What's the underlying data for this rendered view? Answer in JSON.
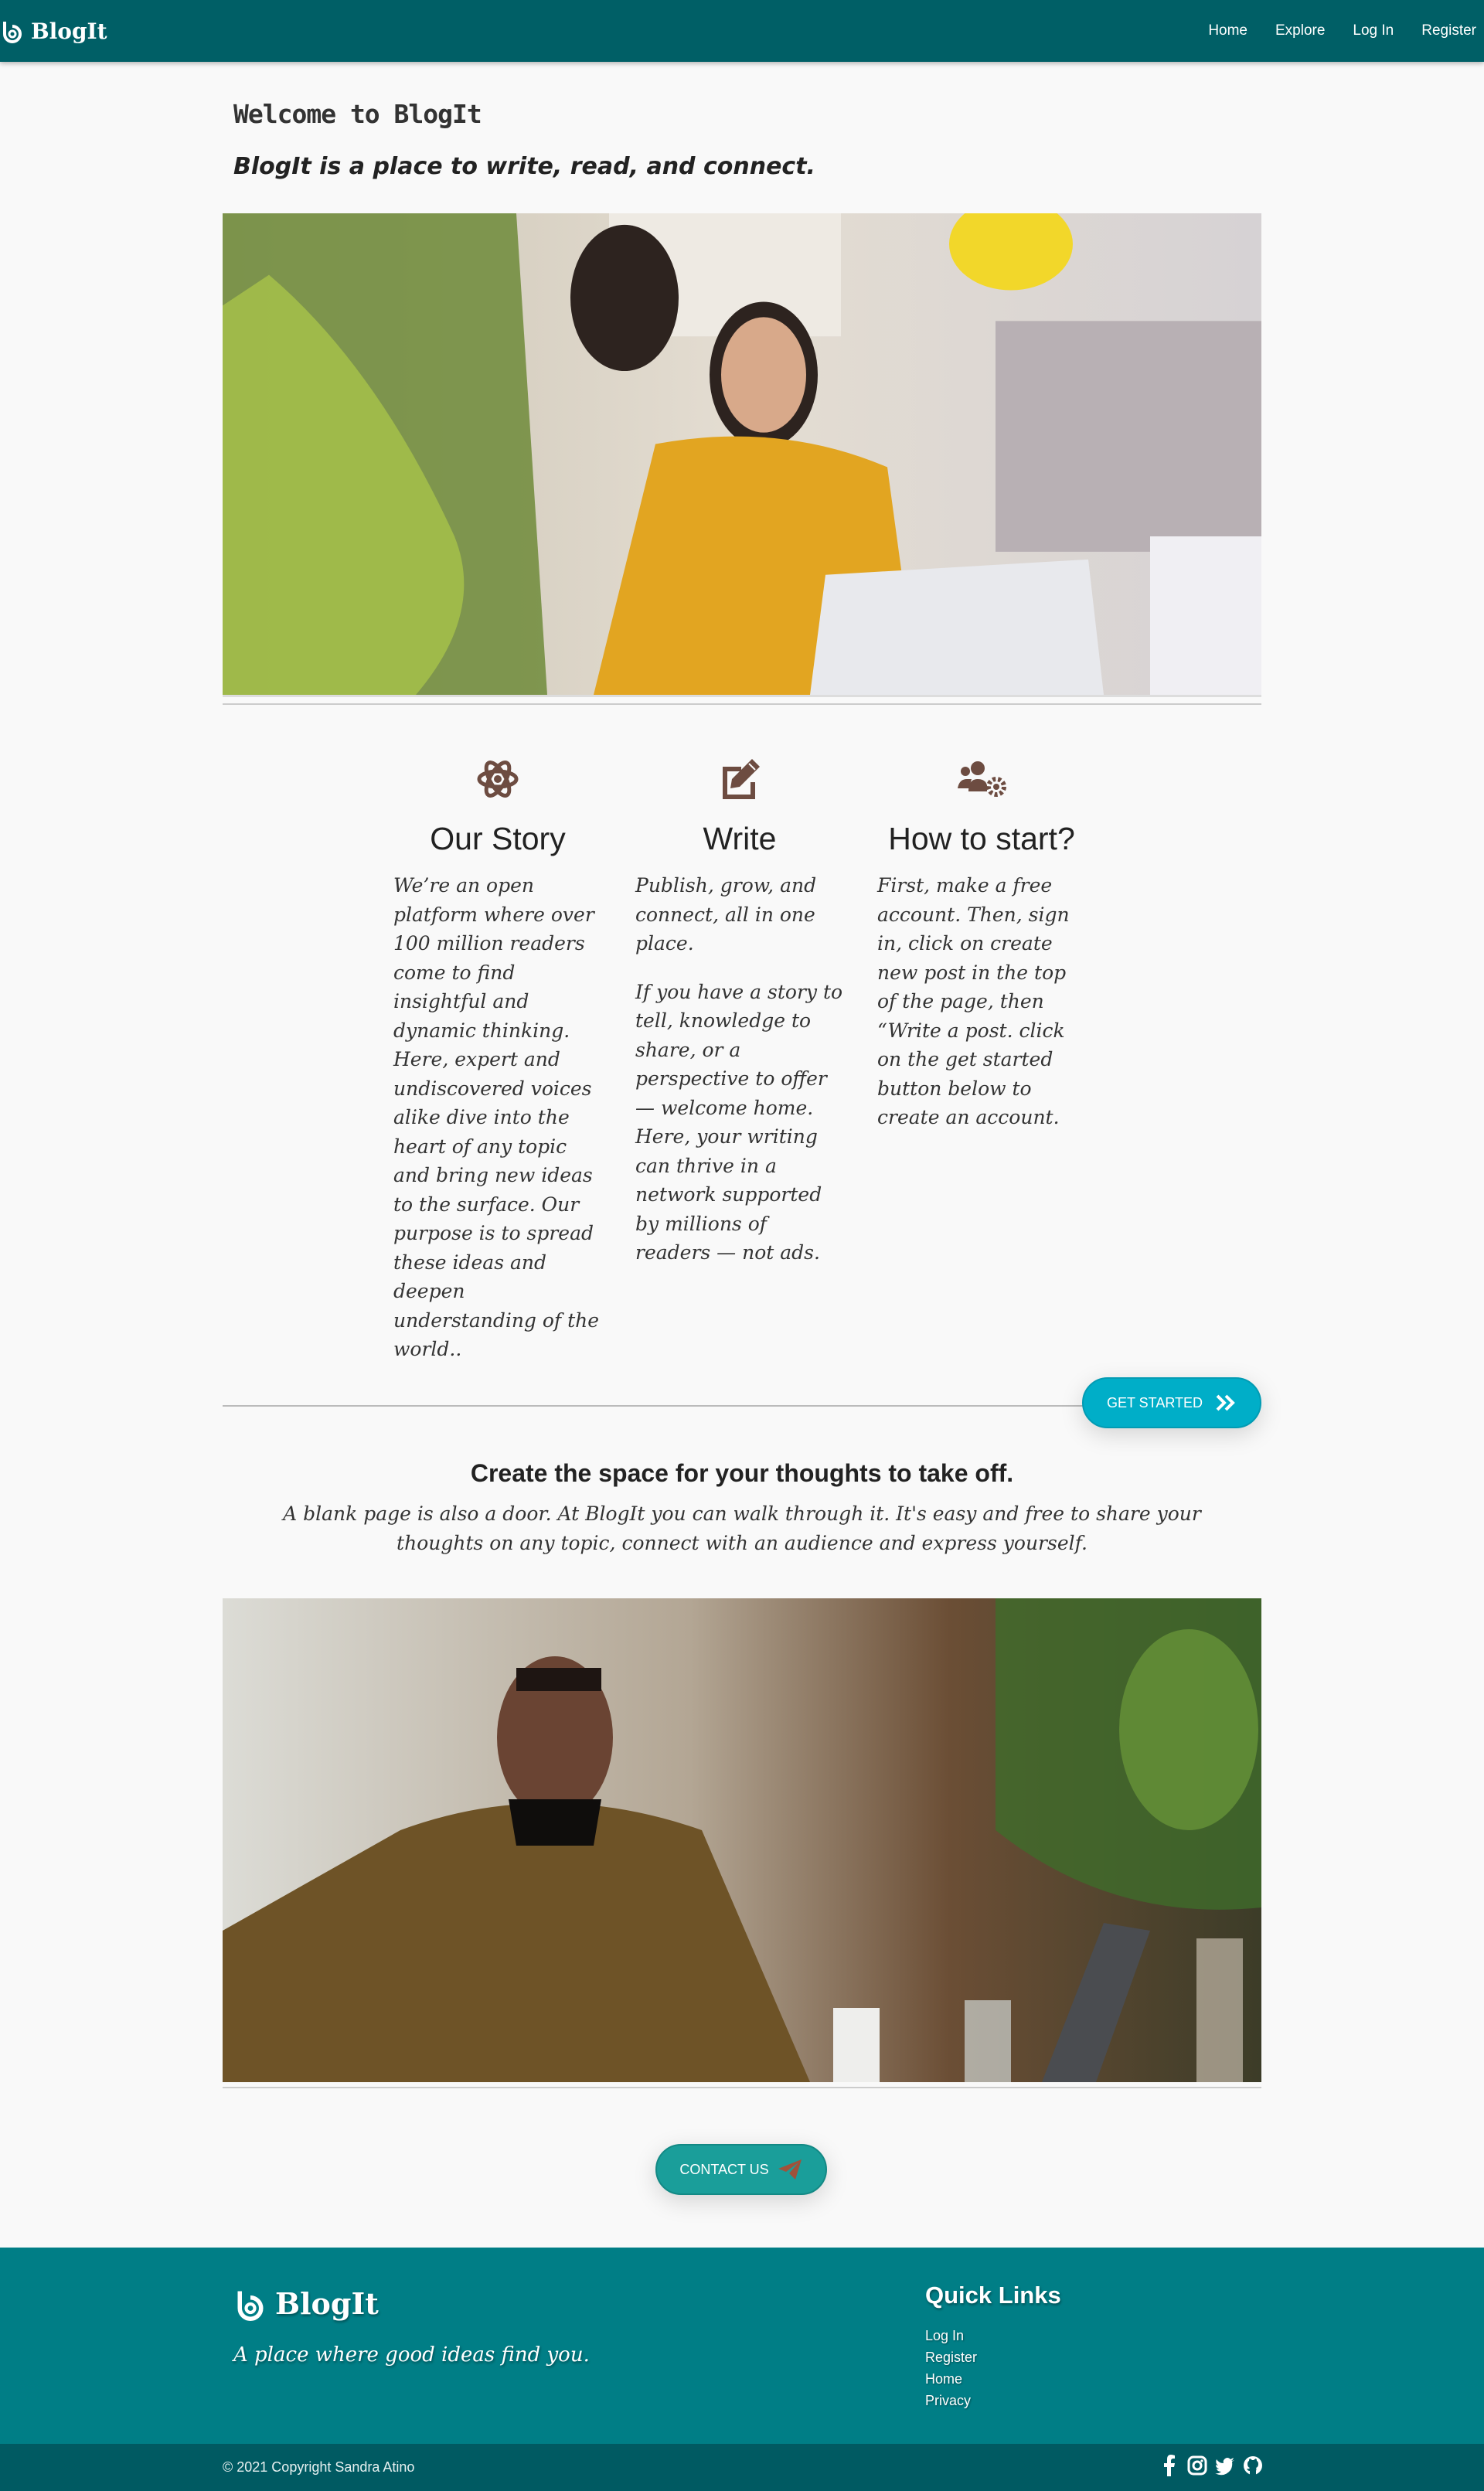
{
  "navbar": {
    "brand": "BlogIt",
    "links": [
      "Home",
      "Explore",
      "Log In",
      "Register"
    ]
  },
  "welcome": {
    "title": "Welcome to BlogIt",
    "subtitle": "BlogIt is a place to write, read, and connect."
  },
  "features": [
    {
      "icon": "atom-icon",
      "title": "Our Story",
      "paragraphs": [
        "We’re an open platform where over 100 million readers come to find insightful and dynamic thinking. Here, expert and undiscovered voices alike dive into the heart of any topic and bring new ideas to the surface. Our purpose is to spread these ideas and deepen understanding of the world.."
      ]
    },
    {
      "icon": "edit-icon",
      "title": "Write",
      "paragraphs": [
        "Publish, grow, and connect, all in one place.",
        "If you have a story to tell, knowledge to share, or a perspective to offer — welcome home. Here, your writing can thrive in a network supported by millions of readers — not ads."
      ]
    },
    {
      "icon": "users-cog-icon",
      "title": "How to start?",
      "paragraphs": [
        "First, make a free account. Then, sign in, click on create new post in the top of the page, then “Write a post. click on the get started button below to create an account."
      ]
    }
  ],
  "get_started": "GET STARTED",
  "space": {
    "title": "Create the space for your thoughts to take off.",
    "text": "A blank page is also a door. At BlogIt you can walk through it. It's easy and free to share your thoughts on any topic, connect with an audience and express yourself."
  },
  "contact": "CONTACT US",
  "footer": {
    "brand": "BlogIt",
    "tagline": "A place where good ideas find you.",
    "quick_title": "Quick Links",
    "quick_links": [
      "Log In",
      "Register",
      "Home",
      "Privacy"
    ],
    "copyright": "© 2021 Copyright Sandra Atino",
    "socials": [
      "facebook-icon",
      "instagram-icon",
      "twitter-icon",
      "github-icon"
    ]
  },
  "colors": {
    "navbar": "#005f66",
    "footer": "#007e86",
    "copybar": "#005a62",
    "accent_button": "#00aec8",
    "contact_button": "#1a9e9a",
    "feature_icon": "#6d4c41"
  }
}
